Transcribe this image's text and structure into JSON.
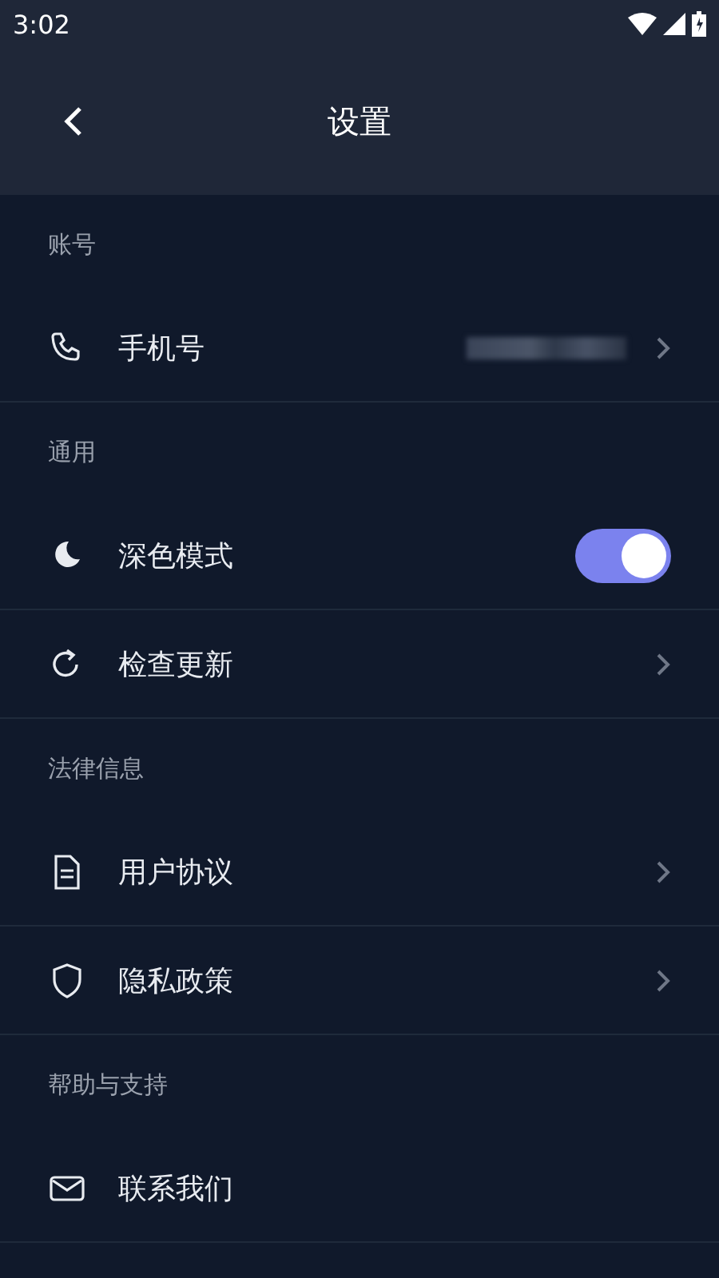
{
  "status_bar": {
    "time": "3:02"
  },
  "header": {
    "title": "设置"
  },
  "sections": [
    {
      "title": "账号",
      "rows": [
        {
          "kind": "link",
          "label": "手机号",
          "masked": true
        }
      ]
    },
    {
      "title": "通用",
      "rows": [
        {
          "kind": "toggle",
          "label": "深色模式",
          "on": true
        },
        {
          "kind": "link",
          "label": "检查更新"
        }
      ]
    },
    {
      "title": "法律信息",
      "rows": [
        {
          "kind": "link",
          "label": "用户协议"
        },
        {
          "kind": "link",
          "label": "隐私政策"
        }
      ]
    },
    {
      "title": "帮助与支持",
      "rows": [
        {
          "kind": "plain",
          "label": "联系我们"
        }
      ]
    }
  ]
}
